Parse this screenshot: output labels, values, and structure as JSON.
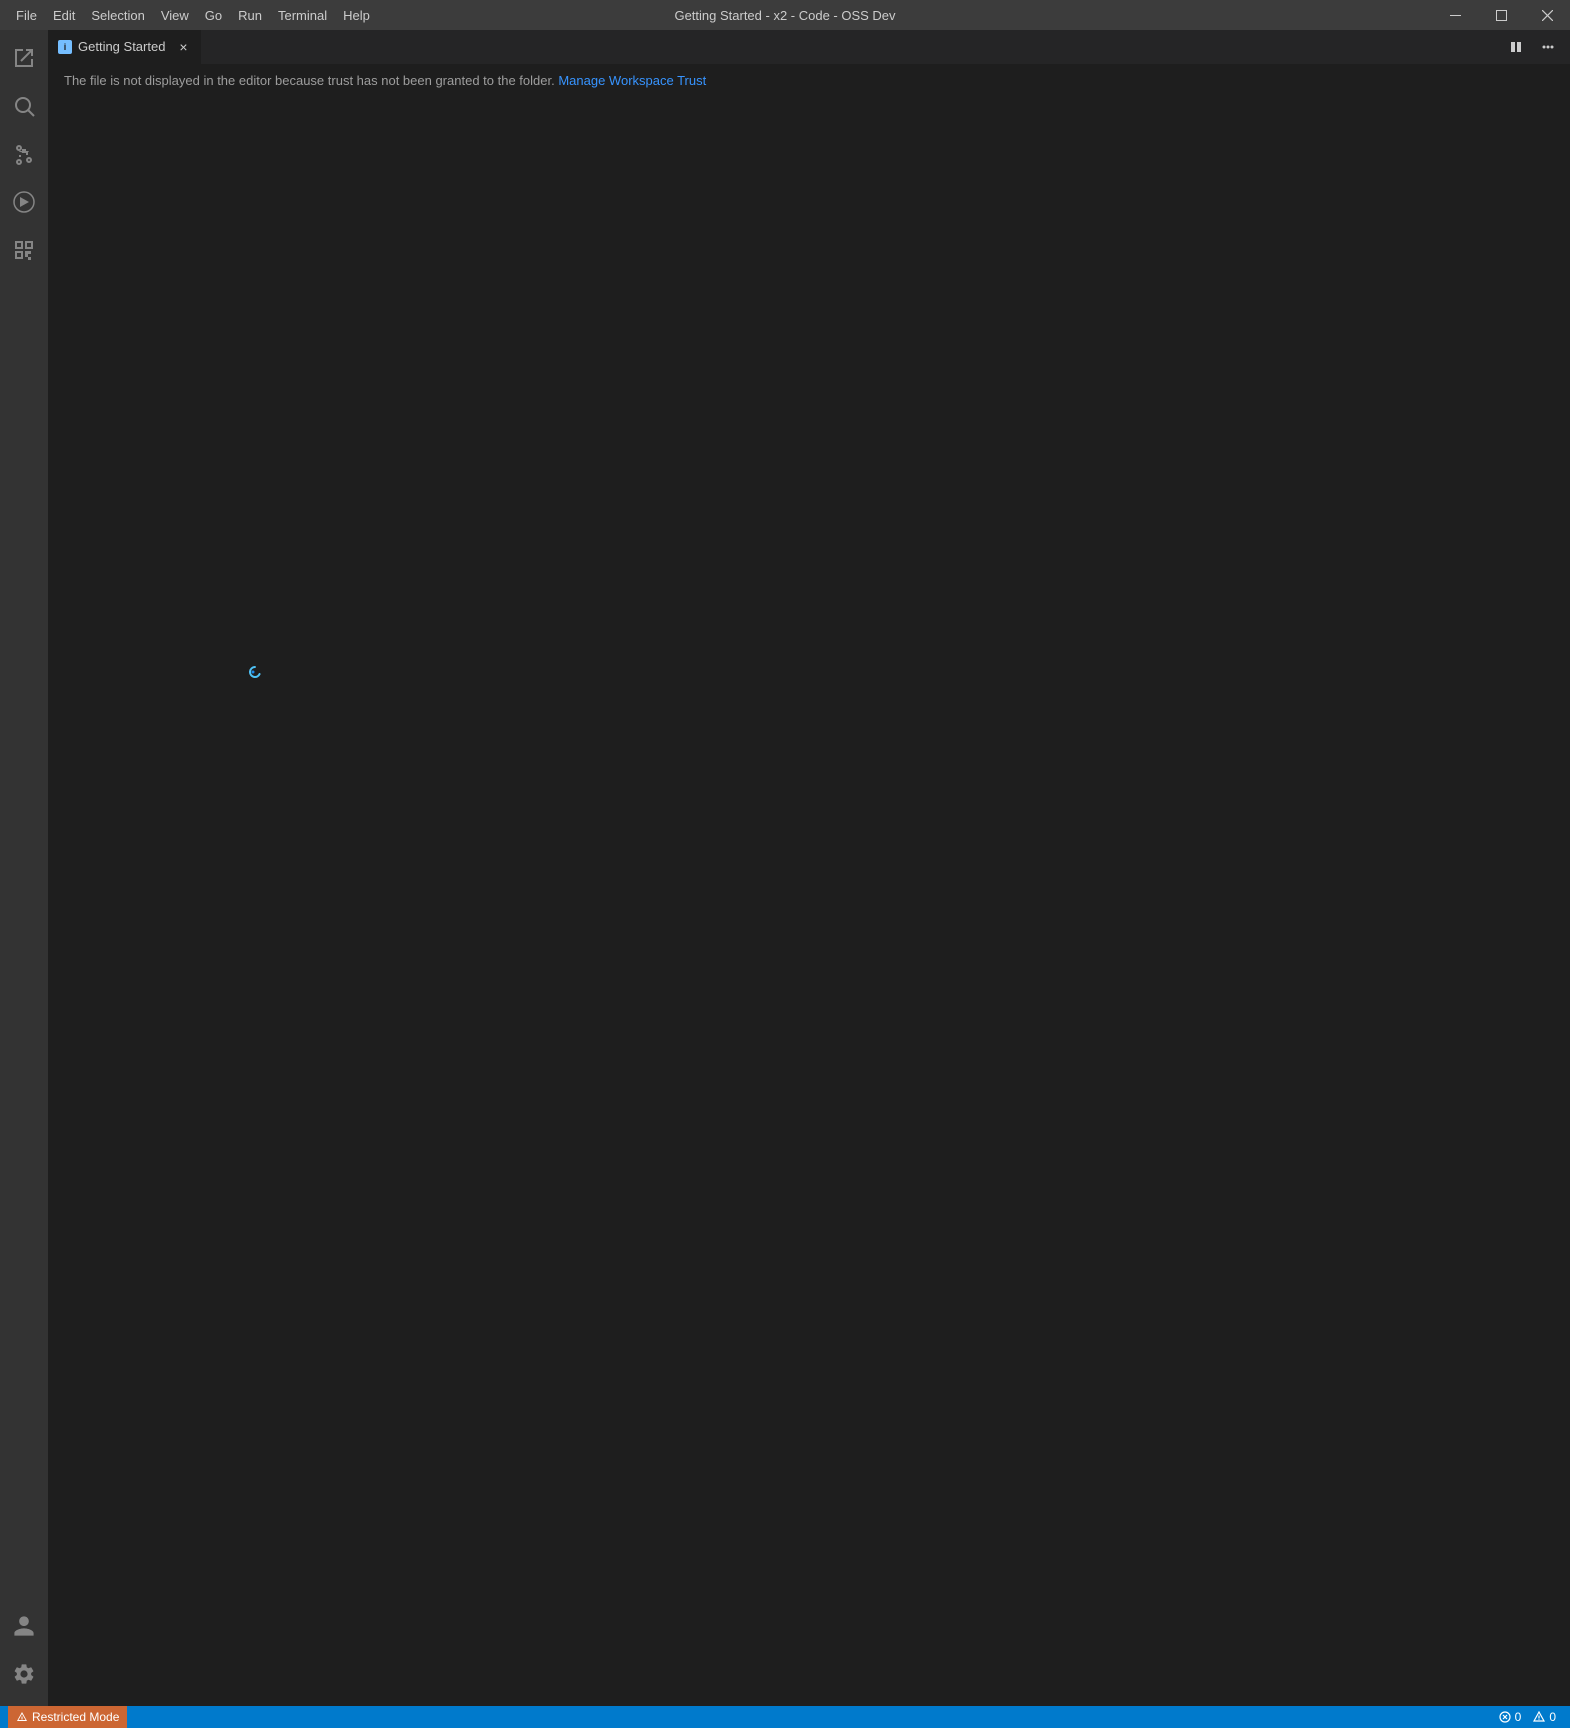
{
  "titleBar": {
    "title": "Getting Started - x2 - Code - OSS Dev",
    "menuItems": [
      {
        "label": "File",
        "id": "file"
      },
      {
        "label": "Edit",
        "id": "edit"
      },
      {
        "label": "Selection",
        "id": "selection"
      },
      {
        "label": "View",
        "id": "view"
      },
      {
        "label": "Go",
        "id": "go"
      },
      {
        "label": "Run",
        "id": "run"
      },
      {
        "label": "Terminal",
        "id": "terminal"
      },
      {
        "label": "Help",
        "id": "help"
      }
    ],
    "windowControls": {
      "minimize": "─",
      "maximize": "□",
      "close": "✕"
    }
  },
  "tab": {
    "label": "Getting Started",
    "icon": "i",
    "closeLabel": "×"
  },
  "editorArea": {
    "infoMessage": "The file is not displayed in the editor because trust has not been granted to the folder.",
    "infoLink": "Manage Workspace Trust"
  },
  "statusBar": {
    "restrictedMode": "Restricted Mode",
    "errors": "0",
    "warnings": "0"
  },
  "activityBar": {
    "icons": [
      {
        "name": "explorer",
        "tooltip": "Explorer"
      },
      {
        "name": "search",
        "tooltip": "Search"
      },
      {
        "name": "source-control",
        "tooltip": "Source Control"
      },
      {
        "name": "run-debug",
        "tooltip": "Run and Debug"
      },
      {
        "name": "extensions",
        "tooltip": "Extensions"
      }
    ]
  }
}
